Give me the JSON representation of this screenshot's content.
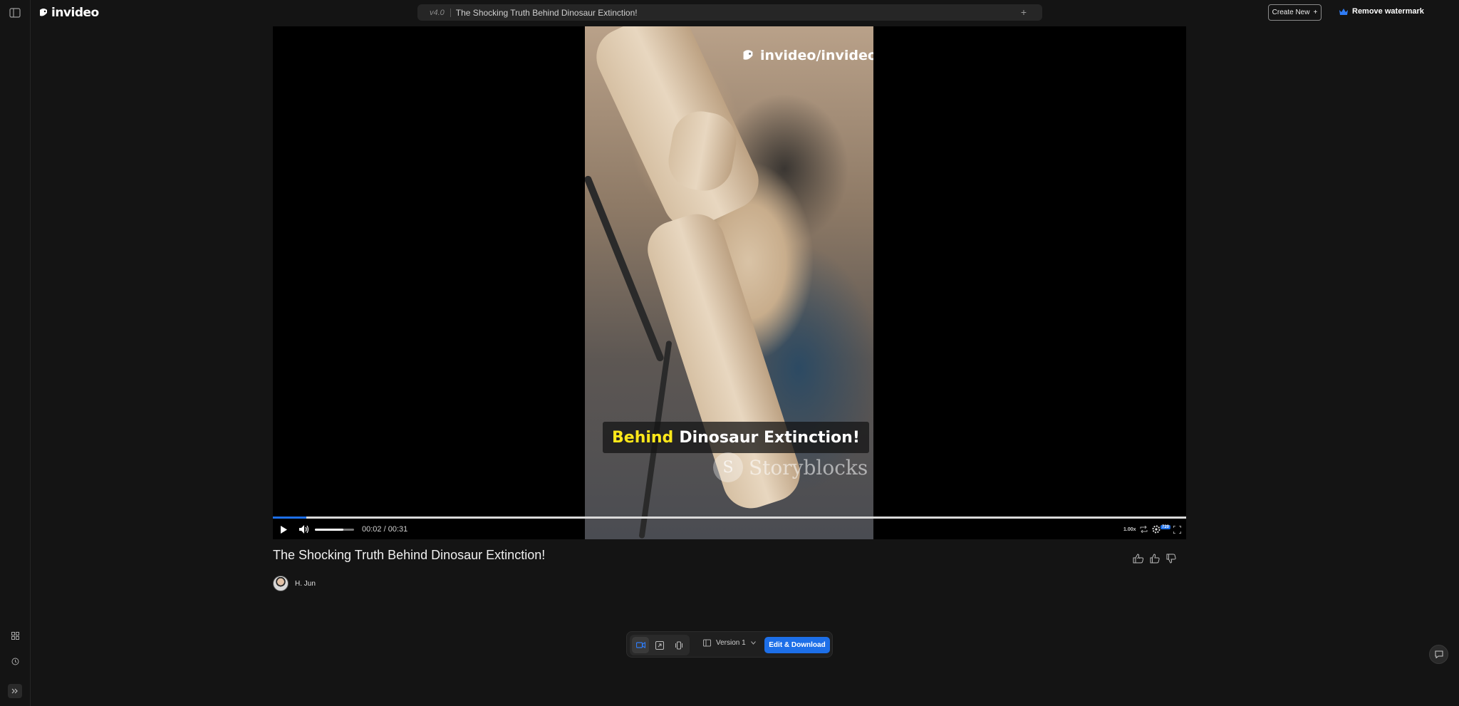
{
  "app": {
    "logo_text": "invideo"
  },
  "header": {
    "version": "v4.0",
    "project_title": "The Shocking Truth Behind Dinosaur Extinction!",
    "create_new_label": "Create New",
    "remove_watermark_label": "Remove watermark"
  },
  "video": {
    "watermark_text": "invideo/invideo-di",
    "caption_highlight": "Behind",
    "caption_rest": "Dinosaur Extinction!",
    "stock_watermark": "Storyblocks",
    "progress": 0.037,
    "volume": 0.72,
    "current_time": "00:02",
    "total_time": "00:31",
    "time_separator": " / ",
    "speed": "1.00x",
    "quality_badge": "720"
  },
  "details": {
    "title": "The Shocking Truth Behind Dinosaur Extinction!",
    "author": "H. Jun"
  },
  "bottom_bar": {
    "version_label": "Version 1",
    "edit_download_label": "Edit & Download"
  },
  "colors": {
    "accent": "#1d6fe8",
    "caption_highlight": "#ffe81a",
    "background": "#141414"
  }
}
